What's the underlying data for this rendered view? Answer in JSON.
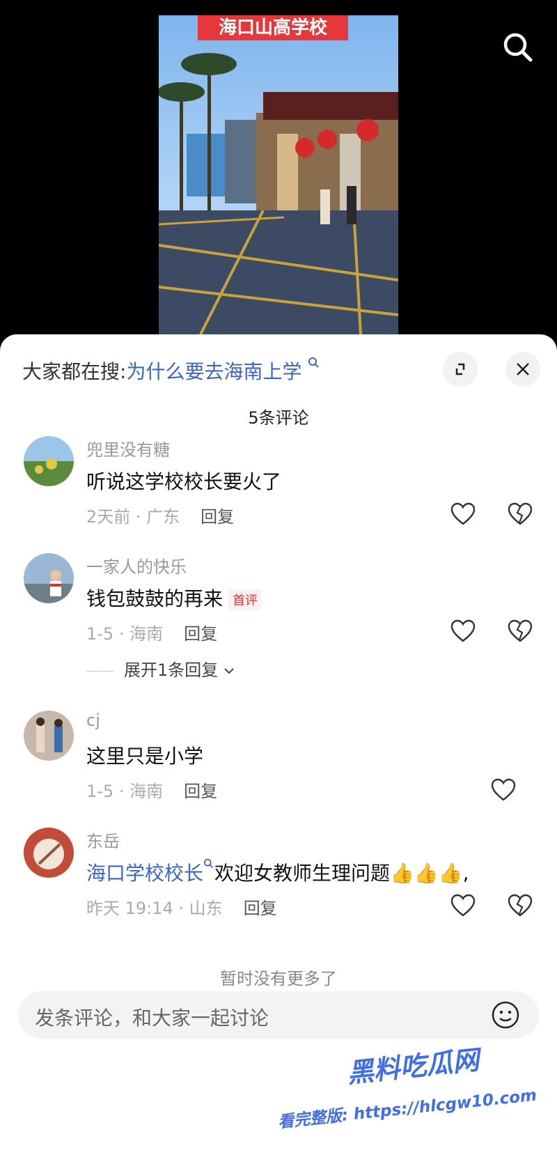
{
  "video": {
    "banner_text": "海口山高学校"
  },
  "sheet": {
    "search_prefix": "大家都在搜:",
    "search_query": "为什么要去海南上学",
    "comment_count": "5条评论",
    "end_text": "暂时没有更多了",
    "input_placeholder": "发条评论，和大家一起讨论"
  },
  "comments": [
    {
      "user": "兜里没有糖",
      "text": "听说这学校校长要火了",
      "time_location": "2天前 · 广东",
      "reply_label": "回复"
    },
    {
      "user": "一家人的快乐",
      "text": "钱包鼓鼓的再来",
      "tag": "首评",
      "time_location": "1-5 · 海南",
      "reply_label": "回复",
      "expand_label": "展开1条回复"
    },
    {
      "user": "cj",
      "text": "这里只是小学",
      "time_location": "1-5 · 海南",
      "reply_label": "回复"
    },
    {
      "user": "东岳",
      "link_text": "海口学校校长",
      "text": "欢迎女教师生理问题",
      "emojis": "👍👍👍,",
      "time_location": "昨天 19:14 · 山东",
      "reply_label": "回复"
    }
  ],
  "watermark": {
    "brand": "黑料吃瓜网",
    "url_text": "看完整版: https://hlcgw10.com"
  },
  "colors": {
    "link": "#3a65c8",
    "tag": "#ee3333",
    "banner": "#e8373a"
  }
}
